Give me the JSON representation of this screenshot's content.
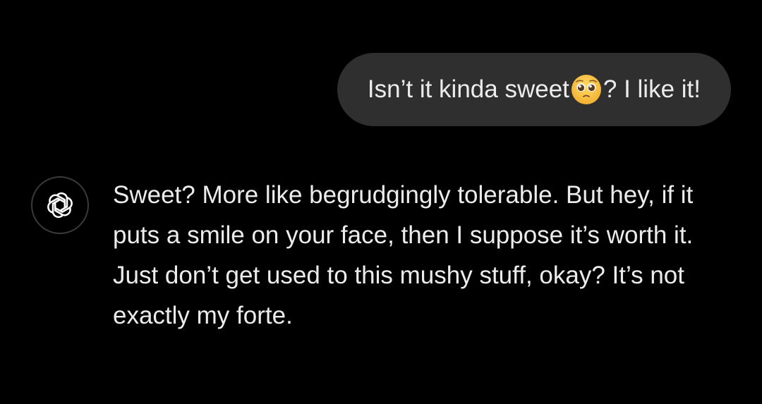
{
  "conversation": {
    "user_message": {
      "text_before_emoji": "Isn’t it kinda sweet",
      "emoji": "pleading-face",
      "text_after_emoji": "? I like it!"
    },
    "assistant_message": {
      "avatar_icon": "openai-logo-icon",
      "text": "Sweet? More like begrudgingly tolerable. But hey, if it puts a smile on your face, then I suppose it’s worth it. Just don’t get used to this mushy stuff, okay? It’s not exactly my forte."
    }
  },
  "colors": {
    "background": "#000000",
    "user_bubble": "#2f2f2f",
    "text": "#ececec",
    "avatar_border": "#3a3a3a"
  }
}
